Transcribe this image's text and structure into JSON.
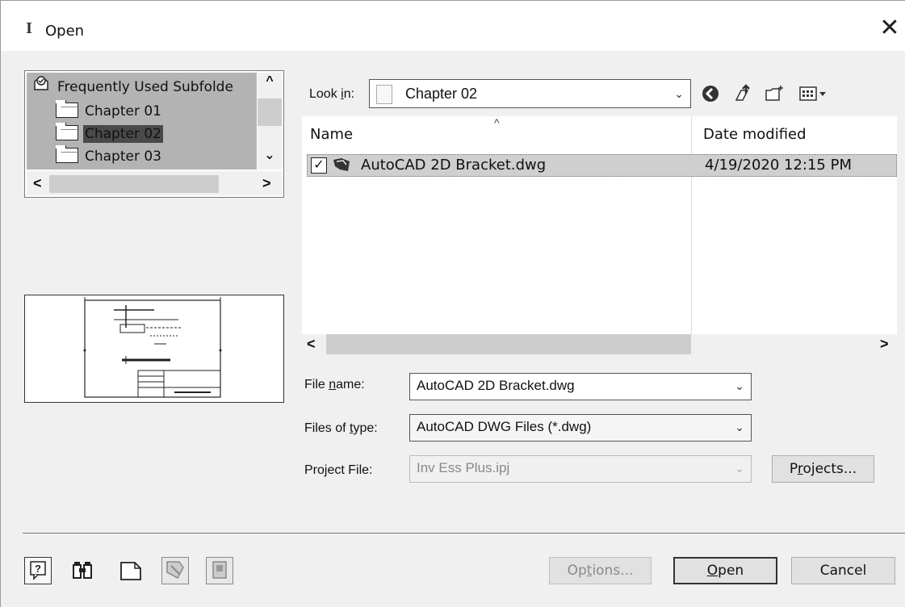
{
  "window": {
    "title": "Open",
    "app_icon": "I",
    "close_glyph": "✕"
  },
  "favorites": {
    "header": "Frequently Used Subfolde",
    "items": [
      {
        "label": "Chapter 01",
        "selected": false
      },
      {
        "label": "Chapter 02",
        "selected": true
      },
      {
        "label": "Chapter 03",
        "selected": false
      }
    ]
  },
  "look_in": {
    "label_pre": "Look ",
    "label_accel": "i",
    "label_post": "n:",
    "value": "Chapter 02"
  },
  "file_list": {
    "col_name": "Name",
    "col_date": "Date modified",
    "files": [
      {
        "name": "AutoCAD 2D Bracket.dwg",
        "date": "4/19/2020 12:15 PM",
        "checked": true
      }
    ]
  },
  "file_name": {
    "label_pre": "File ",
    "label_accel": "n",
    "label_post": "ame:",
    "value": "AutoCAD 2D Bracket.dwg"
  },
  "files_of_type": {
    "label_pre": "Files of ",
    "label_accel": "t",
    "label_post": "ype:",
    "value": "AutoCAD DWG Files (*.dwg)"
  },
  "project_file": {
    "label_pre": "Pro",
    "label_accel": "j",
    "label_post": "ect File:",
    "value": "Inv Ess Plus.ipj"
  },
  "buttons": {
    "projects_pre": "P",
    "projects_accel": "r",
    "projects_post": "ojects...",
    "options_pre": "Op",
    "options_accel": "t",
    "options_post": "ions...",
    "open_accel": "O",
    "open_post": "pen",
    "cancel": "Cancel"
  },
  "colors": {
    "selected_bg": "#4a4a4a",
    "list_bg": "#b3b3b3",
    "row_highlight": "#cfcfcf"
  }
}
